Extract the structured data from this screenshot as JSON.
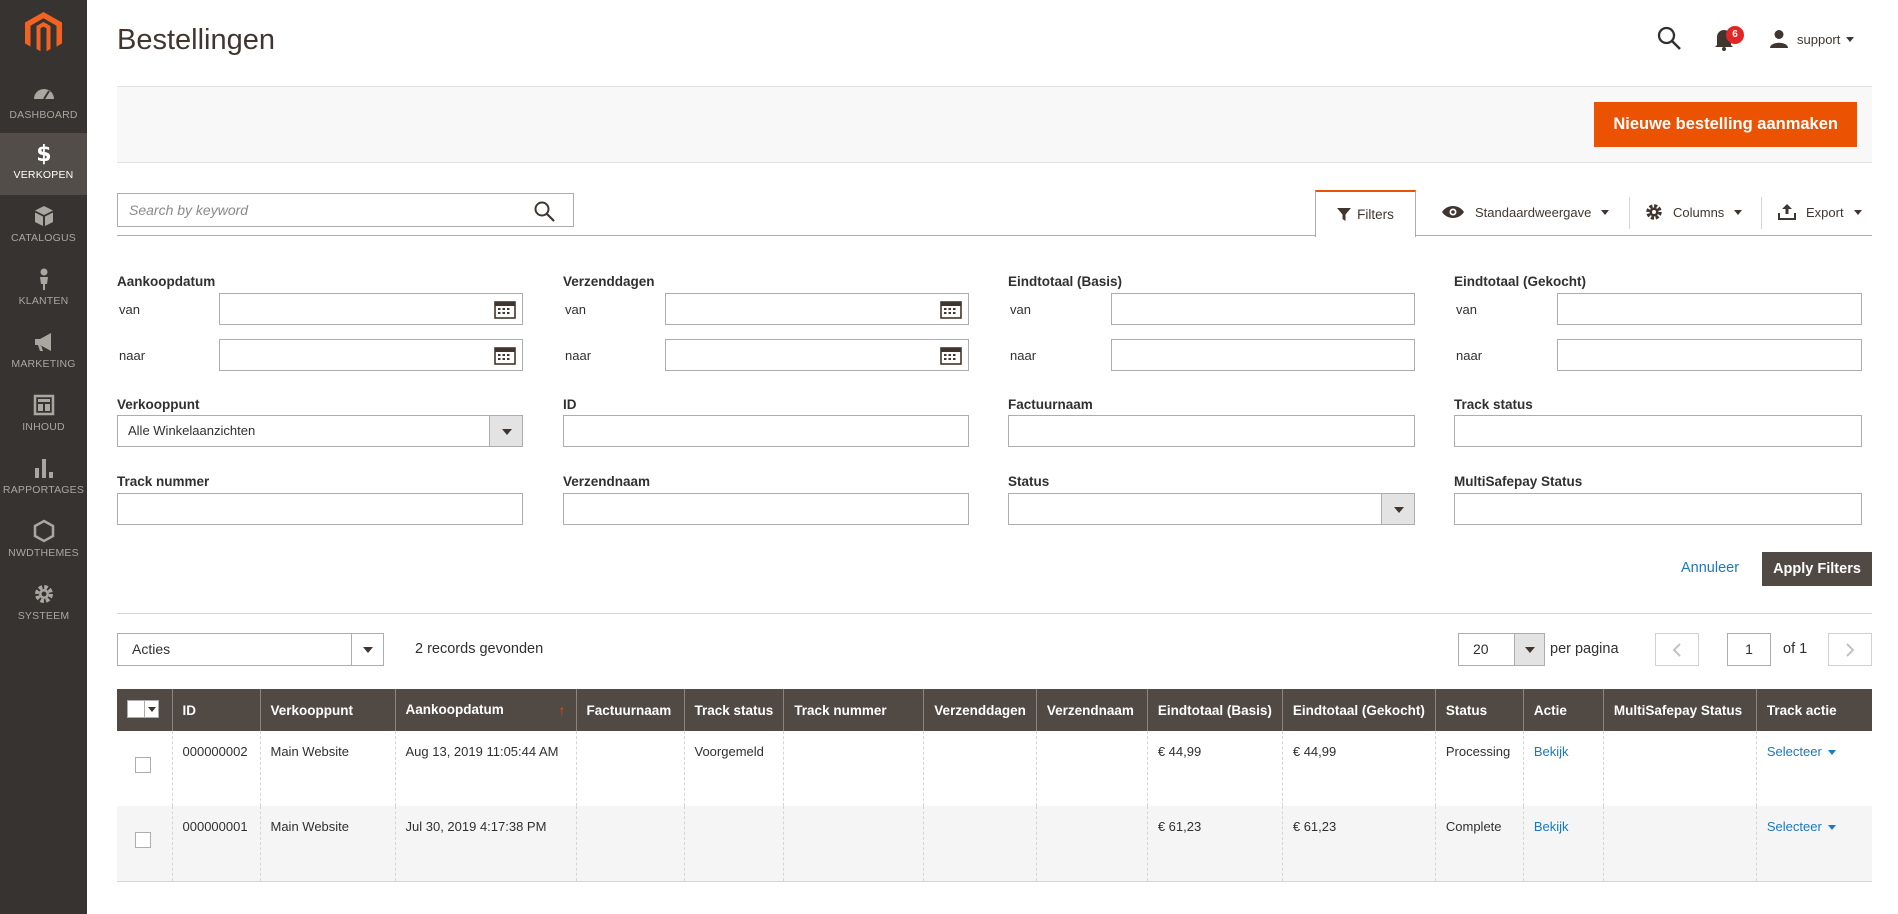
{
  "sidebar": {
    "items": [
      {
        "label": "DASHBOARD",
        "icon": "dashboard-icon"
      },
      {
        "label": "VERKOPEN",
        "icon": "dollar-icon",
        "active": true
      },
      {
        "label": "CATALOGUS",
        "icon": "box-icon"
      },
      {
        "label": "KLANTEN",
        "icon": "person-icon"
      },
      {
        "label": "MARKETING",
        "icon": "megaphone-icon"
      },
      {
        "label": "INHOUD",
        "icon": "layout-icon"
      },
      {
        "label": "RAPPORTAGES",
        "icon": "bar-chart-icon"
      },
      {
        "label": "NWDTHEMES",
        "icon": "hexagon-icon"
      },
      {
        "label": "SYSTEEM",
        "icon": "gear-icon"
      }
    ]
  },
  "header": {
    "title": "Bestellingen",
    "notifications": "6",
    "user": "support"
  },
  "actions": {
    "new_order": "Nieuwe bestelling aanmaken"
  },
  "search": {
    "placeholder": "Search by keyword"
  },
  "controls": {
    "filters": "Filters",
    "view": "Standaardweergave",
    "columns": "Columns",
    "export": "Export"
  },
  "filters": {
    "aankoopdatum": "Aankoopdatum",
    "verzenddagen": "Verzenddagen",
    "eindtotaal_basis": "Eindtotaal (Basis)",
    "eindtotaal_gekocht": "Eindtotaal (Gekocht)",
    "van": "van",
    "naar": "naar",
    "verkooppunt": "Verkooppunt",
    "verkooppunt_value": "Alle Winkelaanzichten",
    "id": "ID",
    "factuurnaam": "Factuurnaam",
    "track_status": "Track status",
    "track_nummer": "Track nummer",
    "verzendnaam": "Verzendnaam",
    "status": "Status",
    "multisafepay_status": "MultiSafepay Status",
    "cancel": "Annuleer",
    "apply": "Apply Filters"
  },
  "toolbar": {
    "acties": "Acties",
    "records": "2 records gevonden",
    "per_page_value": "20",
    "per_page_label": "per pagina",
    "page": "1",
    "of": "of 1"
  },
  "table": {
    "columns": [
      "ID",
      "Verkooppunt",
      "Aankoopdatum",
      "Factuurnaam",
      "Track status",
      "Track nummer",
      "Verzenddagen",
      "Verzendnaam",
      "Eindtotaal (Basis)",
      "Eindtotaal (Gekocht)",
      "Status",
      "Actie",
      "MultiSafepay Status",
      "Track actie"
    ],
    "rows": [
      {
        "id": "000000002",
        "verkooppunt": "Main Website",
        "aankoopdatum": "Aug 13, 2019 11:05:44 AM",
        "factuurnaam": "",
        "track_status": "Voorgemeld",
        "track_nummer": "",
        "verzenddagen": "",
        "verzendnaam": "",
        "basis": "€ 44,99",
        "gekocht": "€ 44,99",
        "status": "Processing",
        "actie": "Bekijk",
        "msp_status": "",
        "track_actie": "Selecteer"
      },
      {
        "id": "000000001",
        "verkooppunt": "Main Website",
        "aankoopdatum": "Jul 30, 2019 4:17:38 PM",
        "factuurnaam": "",
        "track_status": "",
        "track_nummer": "",
        "verzenddagen": "",
        "verzendnaam": "",
        "basis": "€ 61,23",
        "gekocht": "€ 61,23",
        "status": "Complete",
        "actie": "Bekijk",
        "msp_status": "",
        "track_actie": "Selecteer"
      }
    ]
  },
  "colors": {
    "accent": "#eb5202",
    "sidebar": "#373330",
    "header_dark": "#514943",
    "link": "#1979c3"
  }
}
